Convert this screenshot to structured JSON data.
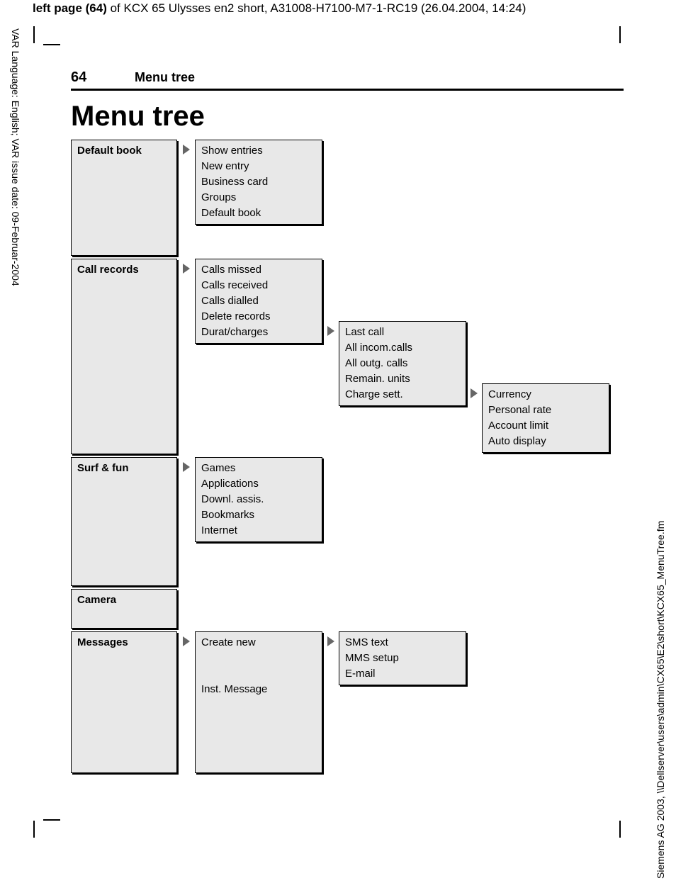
{
  "header": {
    "page_label": "left page (64)",
    "doc_title": " of KCX 65 Ulysses en2 short, A31008-H7100-M7-1-RC19 (26.04.2004, 14:24)"
  },
  "margins": {
    "left_text": "VAR Language: English; VAR issue date: 09-Februar-2004",
    "right_text": "Siemens AG 2003, \\\\Dellserver\\users\\admin\\CX65\\E2\\short\\KCX65_MenuTree.fm"
  },
  "running_head": {
    "page_number": "64",
    "section": "Menu tree"
  },
  "title": "Menu tree",
  "menus": {
    "default_book": {
      "label": "Default book",
      "items": [
        "Show entries",
        "New entry",
        "Business card",
        "Groups",
        "Default book"
      ]
    },
    "call_records": {
      "label": "Call records",
      "items": [
        "Calls missed",
        "Calls received",
        "Calls dialled",
        "Delete records",
        "Durat/charges"
      ],
      "durat_sub": [
        "Last call",
        "All incom.calls",
        "All outg. calls",
        "Remain. units",
        "Charge sett."
      ],
      "charge_sub": [
        "Currency",
        "Personal rate",
        "Account limit",
        "Auto display"
      ]
    },
    "surf_fun": {
      "label": "Surf & fun",
      "items": [
        "Games",
        "Applications",
        "Downl. assis.",
        "Bookmarks",
        "Internet"
      ]
    },
    "camera": {
      "label": "Camera"
    },
    "messages": {
      "label": "Messages",
      "items_top": [
        "Create new"
      ],
      "items_bottom": [
        "Inst. Message"
      ],
      "create_sub": [
        "SMS text",
        "MMS setup",
        "E-mail"
      ]
    }
  }
}
